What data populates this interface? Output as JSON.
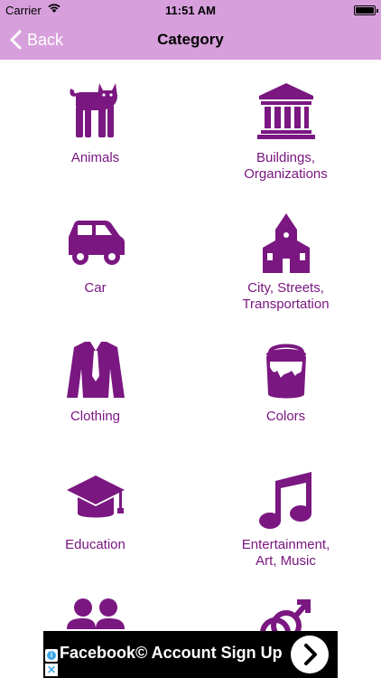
{
  "status": {
    "carrier": "Carrier",
    "time": "11:51 AM",
    "battery_level": 1.0
  },
  "nav": {
    "back_label": "Back",
    "title": "Category"
  },
  "categories": [
    {
      "icon": "cat-icon",
      "label": "Animals"
    },
    {
      "icon": "bank-icon",
      "label": "Buildings,\nOrganizations"
    },
    {
      "icon": "car-icon",
      "label": "Car"
    },
    {
      "icon": "church-icon",
      "label": "City, Streets,\nTransportation"
    },
    {
      "icon": "jacket-icon",
      "label": "Clothing"
    },
    {
      "icon": "paint-bucket-icon",
      "label": "Colors"
    },
    {
      "icon": "graduation-cap-icon",
      "label": "Education"
    },
    {
      "icon": "music-note-icon",
      "label": "Entertainment,\nArt, Music"
    },
    {
      "icon": "people-icon",
      "label": ""
    },
    {
      "icon": "gender-icon",
      "label": ""
    }
  ],
  "ad": {
    "text": "Facebook© Account Sign Up",
    "info_icon": "info-icon",
    "close_icon": "close-icon",
    "action_icon": "chevron-right-icon"
  },
  "colors": {
    "accent": "#7a1781",
    "navbar": "#d7a0dc",
    "ad_background": "#000000",
    "ad_info": "#3da8e8"
  }
}
